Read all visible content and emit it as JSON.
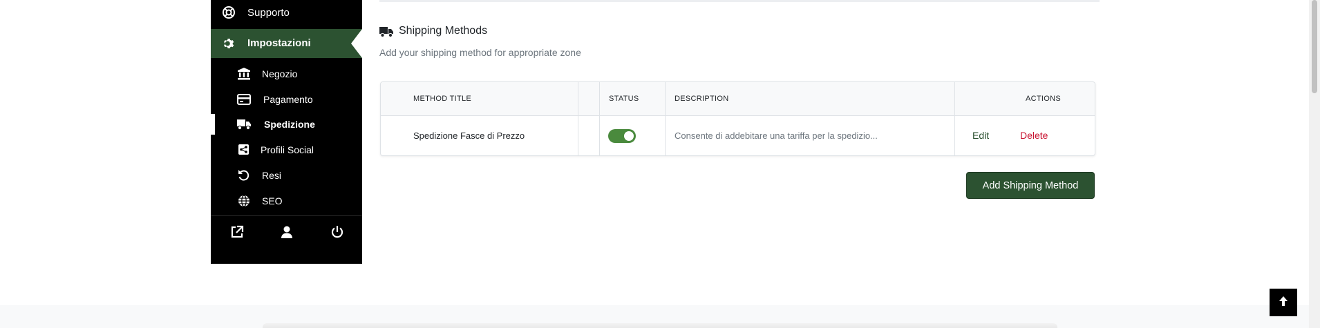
{
  "sidebar": {
    "top_item": {
      "label": "Supporto",
      "icon": "lifebuoy-icon"
    },
    "active_section": {
      "label": "Impostazioni",
      "icon": "gear-icon",
      "color": "#2c5231"
    },
    "sub_items": [
      {
        "label": "Negozio",
        "icon": "bank-icon"
      },
      {
        "label": "Pagamento",
        "icon": "credit-card-icon"
      },
      {
        "label": "Spedizione",
        "icon": "truck-icon",
        "current": true
      },
      {
        "label": "Profili Social",
        "icon": "share-icon"
      },
      {
        "label": "Resi",
        "icon": "undo-icon"
      },
      {
        "label": "SEO",
        "icon": "globe-icon"
      }
    ],
    "bottom_icons": [
      "external-link-icon",
      "user-icon",
      "power-icon"
    ]
  },
  "main": {
    "title": "Shipping Methods",
    "title_icon": "truck-icon",
    "subtitle": "Add your shipping method for appropriate zone",
    "table": {
      "headers": {
        "method_title": "METHOD TITLE",
        "status": "STATUS",
        "description": "DESCRIPTION",
        "actions": "ACTIONS"
      },
      "rows": [
        {
          "method_title": "Spedizione Fasce di Prezzo",
          "status_enabled": true,
          "description": "Consente di addebitare una tariffa per la spedizio...",
          "edit_label": "Edit",
          "delete_label": "Delete"
        }
      ]
    },
    "add_button_label": "Add Shipping Method"
  },
  "colors": {
    "brand_green": "#2c5231",
    "toggle_green": "#4a8a3d",
    "delete_red": "#c8102e"
  }
}
